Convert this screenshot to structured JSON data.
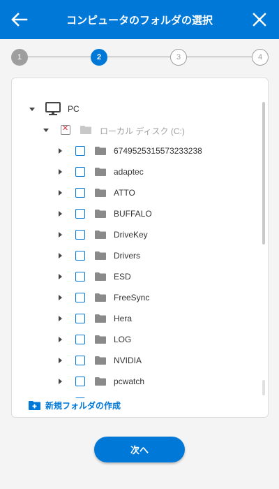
{
  "header": {
    "title": "コンピュータのフォルダの選択",
    "back_icon": "arrow-left-icon",
    "close_icon": "close-icon",
    "color": "#0078d7"
  },
  "stepper": {
    "current": 2,
    "steps": [
      {
        "label": "1",
        "state": "done"
      },
      {
        "label": "2",
        "state": "active"
      },
      {
        "label": "3",
        "state": "todo"
      },
      {
        "label": "4",
        "state": "todo"
      }
    ]
  },
  "tree": {
    "root": {
      "label": "PC",
      "icon": "monitor-icon",
      "expanded": true
    },
    "drive": {
      "label": "ローカル ディスク (C:)",
      "icon": "folder-icon",
      "expanded": true,
      "checked": "mixed"
    },
    "folders": [
      {
        "label": "6749525315573233238",
        "checked": false
      },
      {
        "label": "adaptec",
        "checked": false
      },
      {
        "label": "ATTO",
        "checked": false
      },
      {
        "label": "BUFFALO",
        "checked": false
      },
      {
        "label": "DriveKey",
        "checked": false
      },
      {
        "label": "Drivers",
        "checked": false
      },
      {
        "label": "ESD",
        "checked": false
      },
      {
        "label": "FreeSync",
        "checked": false
      },
      {
        "label": "Hera",
        "checked": false
      },
      {
        "label": "LOG",
        "checked": false
      },
      {
        "label": "NVIDIA",
        "checked": false
      },
      {
        "label": "pcwatch",
        "checked": false
      }
    ]
  },
  "new_folder": {
    "label": "新規フォルダの作成",
    "icon": "folder-plus-icon"
  },
  "next_button": {
    "label": "次へ"
  },
  "colors": {
    "accent": "#0078d7",
    "inactive": "#9e9e9e",
    "folder": "#8a8a8a",
    "error": "#d9343c"
  }
}
